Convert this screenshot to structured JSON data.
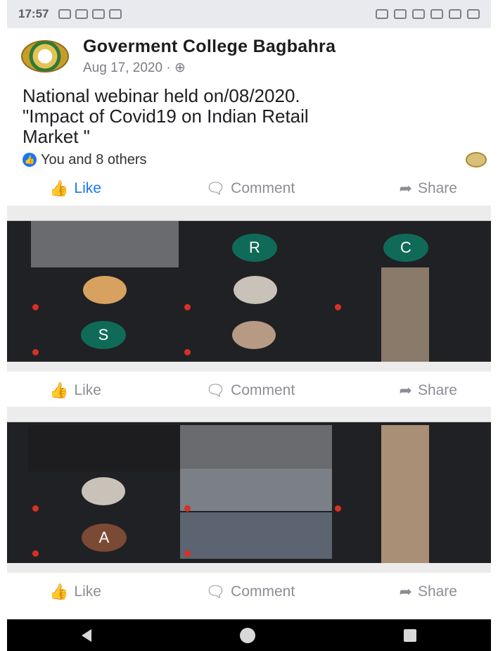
{
  "status_bar": {
    "time": "17:57"
  },
  "post": {
    "page_name": "Goverment  College Bagbahra",
    "date": "Aug 17, 2020 · ",
    "text_line1": "National webinar held on/08/2020.",
    "text_line2": "\"Impact of Covid19 on Indian Retail",
    "text_line3": "Market  \"",
    "reactions": "You and 8 others"
  },
  "actions": {
    "like": "Like",
    "comment": "Comment",
    "share": "Share"
  },
  "shot1": {
    "letters": [
      "R",
      "C",
      "S"
    ],
    "colors": {
      "r": "#0f6b57",
      "c": "#0f6b57",
      "s": "#0f6b57"
    }
  },
  "shot2": {
    "letters": [
      "A"
    ],
    "colors": {
      "a": "#7b4a35"
    }
  },
  "colors": {
    "brand": "#1877f2",
    "meeting_bg": "#202124"
  }
}
